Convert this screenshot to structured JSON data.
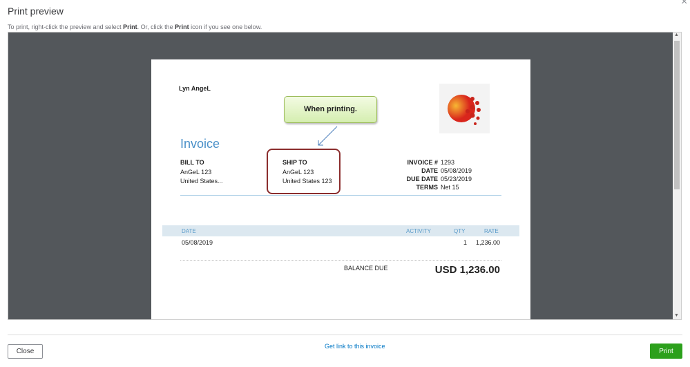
{
  "dialog": {
    "title": "Print preview",
    "hint_pre": "To print, right-click the preview and select ",
    "hint_b1": "Print",
    "hint_mid": ". Or, click the ",
    "hint_b2": "Print",
    "hint_post": " icon if you see one below.",
    "close_icon": "×"
  },
  "invoice": {
    "company": "Lyn AngeL",
    "title": "Invoice",
    "bill_to": {
      "label": "BILL TO",
      "line1": "AnGeL 123",
      "line2": "United States..."
    },
    "ship_to": {
      "label": "SHIP TO",
      "line1": "AnGeL 123",
      "line2": "United States 123"
    },
    "meta": [
      {
        "label": "INVOICE #",
        "value": "1293"
      },
      {
        "label": "DATE",
        "value": "05/08/2019"
      },
      {
        "label": "DUE DATE",
        "value": "05/23/2019"
      },
      {
        "label": "TERMS",
        "value": "Net 15"
      }
    ],
    "columns": {
      "date": "DATE",
      "activity": "ACTIVITY",
      "qty": "QTY",
      "rate": "RATE"
    },
    "rows": [
      {
        "date": "05/08/2019",
        "activity": "",
        "qty": "1",
        "rate": "1,236.00"
      }
    ],
    "balance_label": "BALANCE DUE",
    "balance_value": "USD 1,236.00"
  },
  "annotation": {
    "callout": "When printing."
  },
  "footer": {
    "close": "Close",
    "link": "Get link to this invoice",
    "print": "Print"
  },
  "colors": {
    "print_button": "#2ca01c",
    "link": "#0077c5",
    "annotation_border": "#8b2d2d"
  }
}
